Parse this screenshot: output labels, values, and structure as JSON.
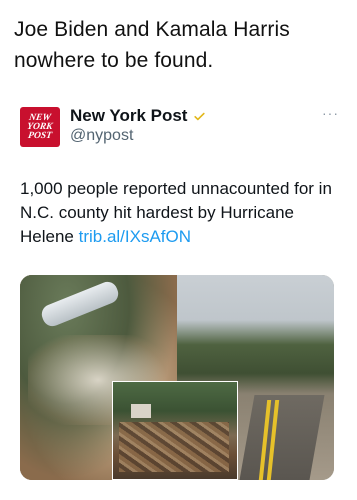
{
  "caption": "Joe Biden and Kamala Harris nowhere to be found.",
  "tweet": {
    "avatar_lines": [
      "NEW",
      "YORK",
      "POST"
    ],
    "name": "New York Post",
    "handle": "@nypost",
    "more": "···",
    "text": "1,000 people reported unnacounted for in N.C. county hit hardest by Hurricane Helene ",
    "link": "trib.al/IXsAfON"
  },
  "colors": {
    "link": "#1d9bf0",
    "brand_red": "#c8102e",
    "verified": "#e2b719",
    "secondary_text": "#536471"
  },
  "icons": {
    "verified": "verified-badge-icon",
    "more": "more-icon"
  }
}
